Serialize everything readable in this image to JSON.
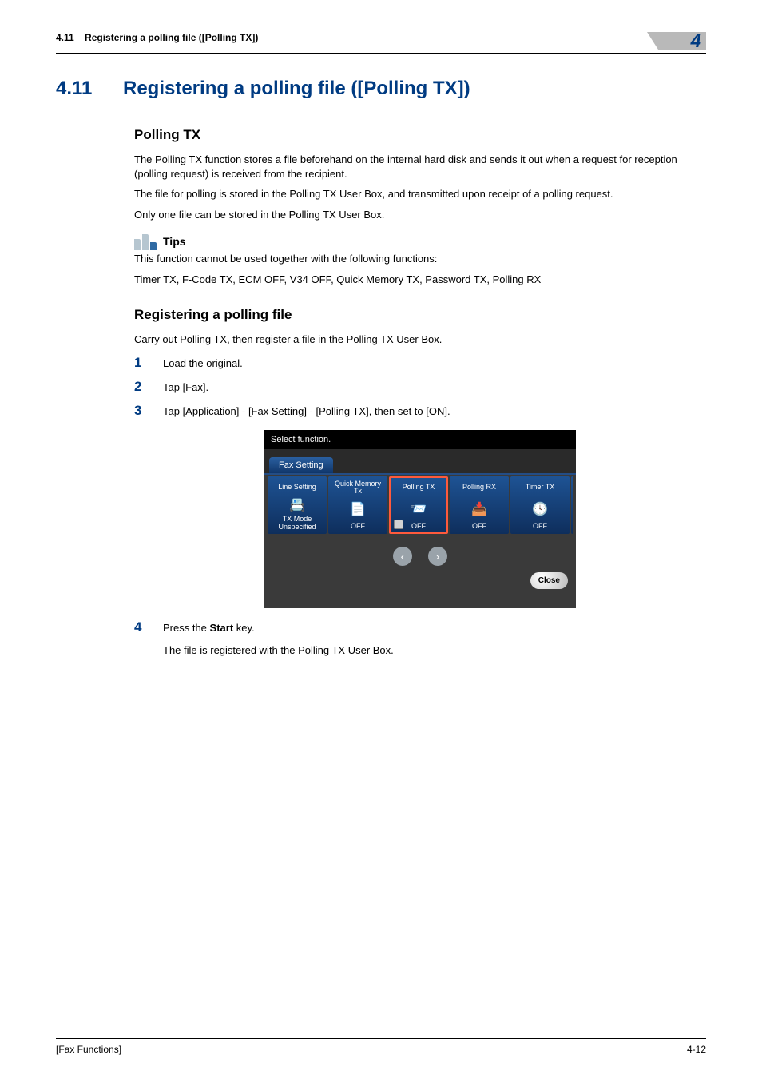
{
  "header": {
    "section_number": "4.11",
    "section_title_short": "Registering a polling file ([Polling TX])",
    "chapter_number": "4"
  },
  "h1": {
    "number": "4.11",
    "text": "Registering a polling file ([Polling TX])"
  },
  "s1": {
    "heading": "Polling TX",
    "p1": "The Polling TX function stores a file beforehand on the internal hard disk and sends it out when a request for reception (polling request) is received from the recipient.",
    "p2": "The file for polling is stored in the Polling TX User Box, and transmitted upon receipt of a polling request.",
    "p3": "Only one file can be stored in the Polling TX User Box."
  },
  "tips": {
    "label": "Tips",
    "line1": "This function cannot be used together with the following functions:",
    "line2": "Timer TX, F-Code TX, ECM OFF, V34 OFF, Quick Memory TX, Password TX, Polling RX"
  },
  "s2": {
    "heading": "Registering a polling file",
    "intro": "Carry out Polling TX, then register a file in the Polling TX User Box.",
    "steps": [
      {
        "n": "1",
        "t": "Load the original."
      },
      {
        "n": "2",
        "t": "Tap [Fax]."
      },
      {
        "n": "3",
        "t": "Tap [Application] - [Fax Setting] - [Polling TX], then set to [ON]."
      },
      {
        "n": "4",
        "t_prefix": "Press the ",
        "t_bold": "Start",
        "t_suffix": " key."
      }
    ],
    "step4_sub": "The file is registered with the Polling TX User Box."
  },
  "screenshot": {
    "prompt": "Select function.",
    "tab": "Fax Setting",
    "cells": [
      {
        "title": "Line Setting",
        "value": "TX Mode Unspecified",
        "icon": "📇",
        "selected": false
      },
      {
        "title": "Quick Memory Tx",
        "value": "OFF",
        "icon": "📄",
        "selected": false
      },
      {
        "title": "Polling TX",
        "value": "OFF",
        "icon": "📨",
        "selected": true,
        "checkbox": true
      },
      {
        "title": "Polling RX",
        "value": "OFF",
        "icon": "📥",
        "selected": false
      },
      {
        "title": "Timer TX",
        "value": "OFF",
        "icon": "🕓",
        "selected": false
      }
    ],
    "close": "Close"
  },
  "footer": {
    "left": "[Fax Functions]",
    "right": "4-12"
  }
}
